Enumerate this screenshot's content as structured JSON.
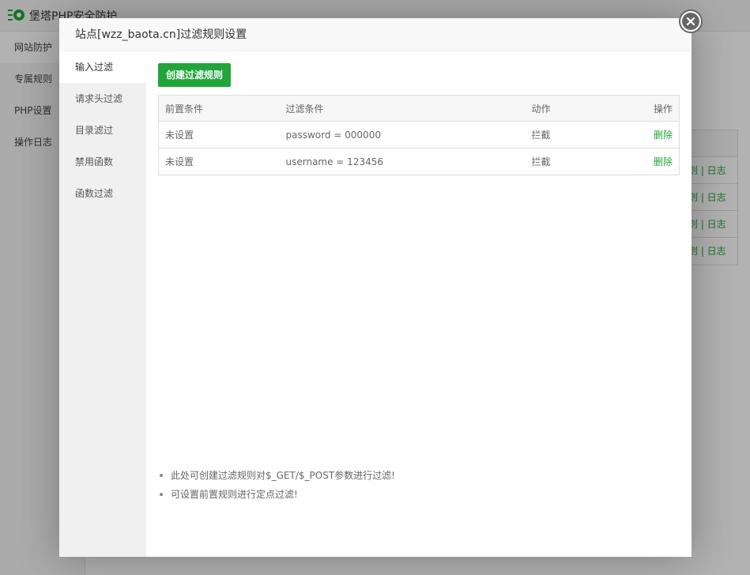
{
  "background": {
    "app_title": "堡塔PHP安全防护",
    "nav": [
      {
        "label": "网站防护"
      },
      {
        "label": "专属规则"
      },
      {
        "label": "PHP设置"
      },
      {
        "label": "操作日志"
      }
    ],
    "table_links": [
      "则 | 日志",
      "则 | 日志",
      "则 | 日志",
      "则 | 日志"
    ]
  },
  "modal": {
    "title": "站点[wzz_baota.cn]过滤规则设置",
    "tabs": [
      {
        "label": "输入过滤"
      },
      {
        "label": "请求头过滤"
      },
      {
        "label": "目录滤过"
      },
      {
        "label": "禁用函数"
      },
      {
        "label": "函数过滤"
      }
    ],
    "create_button": "创建过滤规则",
    "table": {
      "headers": {
        "pre": "前置条件",
        "filter": "过滤条件",
        "action": "动作",
        "op": "操作"
      },
      "rows": [
        {
          "pre": "未设置",
          "filter": "password = 000000",
          "action": "拦截",
          "op": "删除"
        },
        {
          "pre": "未设置",
          "filter": "username = 123456",
          "action": "拦截",
          "op": "删除"
        }
      ]
    },
    "tips": [
      "此处可创建过滤规则对$_GET/$_POST参数进行过滤!",
      "可设置前置规则进行定点过滤!"
    ]
  },
  "colors": {
    "accent": "#20a53a"
  }
}
